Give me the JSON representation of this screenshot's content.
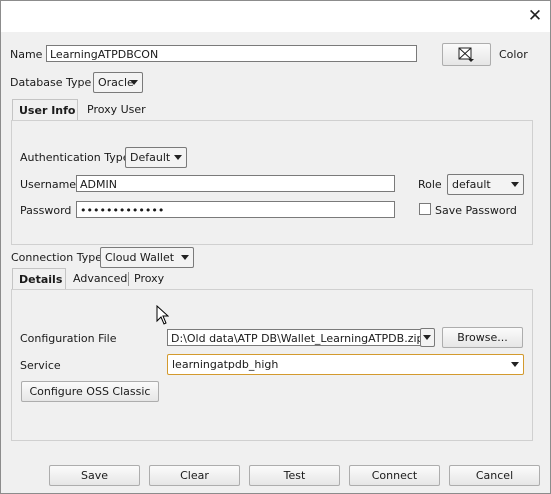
{
  "window": {
    "close_glyph": "✕"
  },
  "name": {
    "label": "Name",
    "value": "LearningATPDBCON"
  },
  "color": {
    "label": "Color"
  },
  "database_type": {
    "label": "Database Type",
    "value": "Oracle"
  },
  "top_tabs": [
    {
      "label": "User Info",
      "active": true
    },
    {
      "label": "Proxy User",
      "active": false
    }
  ],
  "user_info": {
    "auth_type_label": "Authentication Type",
    "auth_type_value": "Default",
    "username_label": "Username",
    "username_value": "ADMIN",
    "password_label": "Password",
    "password_value": "•••••••••••••",
    "role_label": "Role",
    "role_value": "default",
    "save_password_label": "Save Password",
    "save_password_checked": false
  },
  "connection_type": {
    "label": "Connection Type",
    "value": "Cloud Wallet"
  },
  "detail_tabs": [
    {
      "label": "Details",
      "active": true
    },
    {
      "label": "Advanced",
      "active": false
    },
    {
      "label": "Proxy",
      "active": false
    }
  ],
  "details": {
    "config_file_label": "Configuration File",
    "config_file_value": "D:\\Old data\\ATP DB\\Wallet_LearningATPDB.zip",
    "browse_label": "Browse...",
    "service_label": "Service",
    "service_value": "learningatpdb_high",
    "configure_oss_label": "Configure OSS Classic"
  },
  "footer": {
    "save": "Save",
    "clear": "Clear",
    "test": "Test",
    "connect": "Connect",
    "cancel": "Cancel"
  }
}
